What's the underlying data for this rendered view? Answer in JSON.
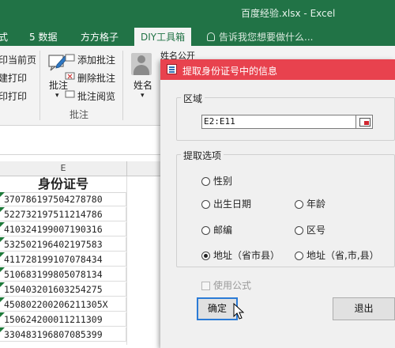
{
  "window": {
    "title": "百度经验.xlsx - Excel"
  },
  "ribbon_tabs": [
    "式",
    "5 数据",
    "方方格子",
    "DIY工具箱"
  ],
  "active_tab_index": 3,
  "tell_me": "告诉我您想要做什么...",
  "ribbon": {
    "print_items": [
      "印当前页",
      "建打印",
      "印打印"
    ],
    "comment_button": "批注",
    "comment_items": [
      "添加批注",
      "删除批注",
      "批注阅览"
    ],
    "comment_group": "批注",
    "name_button": "姓名",
    "name_top_label": "姓名公开"
  },
  "sheet": {
    "column_header": "E",
    "header_cell": "身份证号",
    "rows": [
      "370786197504278780",
      "522732197511214786",
      "410324199007190316",
      "532502196402197583",
      "411728199107078434",
      "510683199805078134",
      "150403201603254275",
      "450802200206211305X",
      "150624200011211309",
      "330483196807085399"
    ]
  },
  "dialog": {
    "title": "提取身份证号中的信息",
    "range_label": "区域",
    "range_value": "E2:E11",
    "options_label": "提取选项",
    "options": {
      "gender": "性别",
      "birth": "出生日期",
      "age": "年龄",
      "postcode": "邮编",
      "area_code": "区号",
      "address_full": "地址（省市县）",
      "address_split": "地址（省,市,县）"
    },
    "selected_option": "address_full",
    "use_formula": "使用公式",
    "ok_label": "确定",
    "exit_label": "退出"
  },
  "colors": {
    "excel_green": "#217346",
    "dialog_title": "#e8424e"
  }
}
